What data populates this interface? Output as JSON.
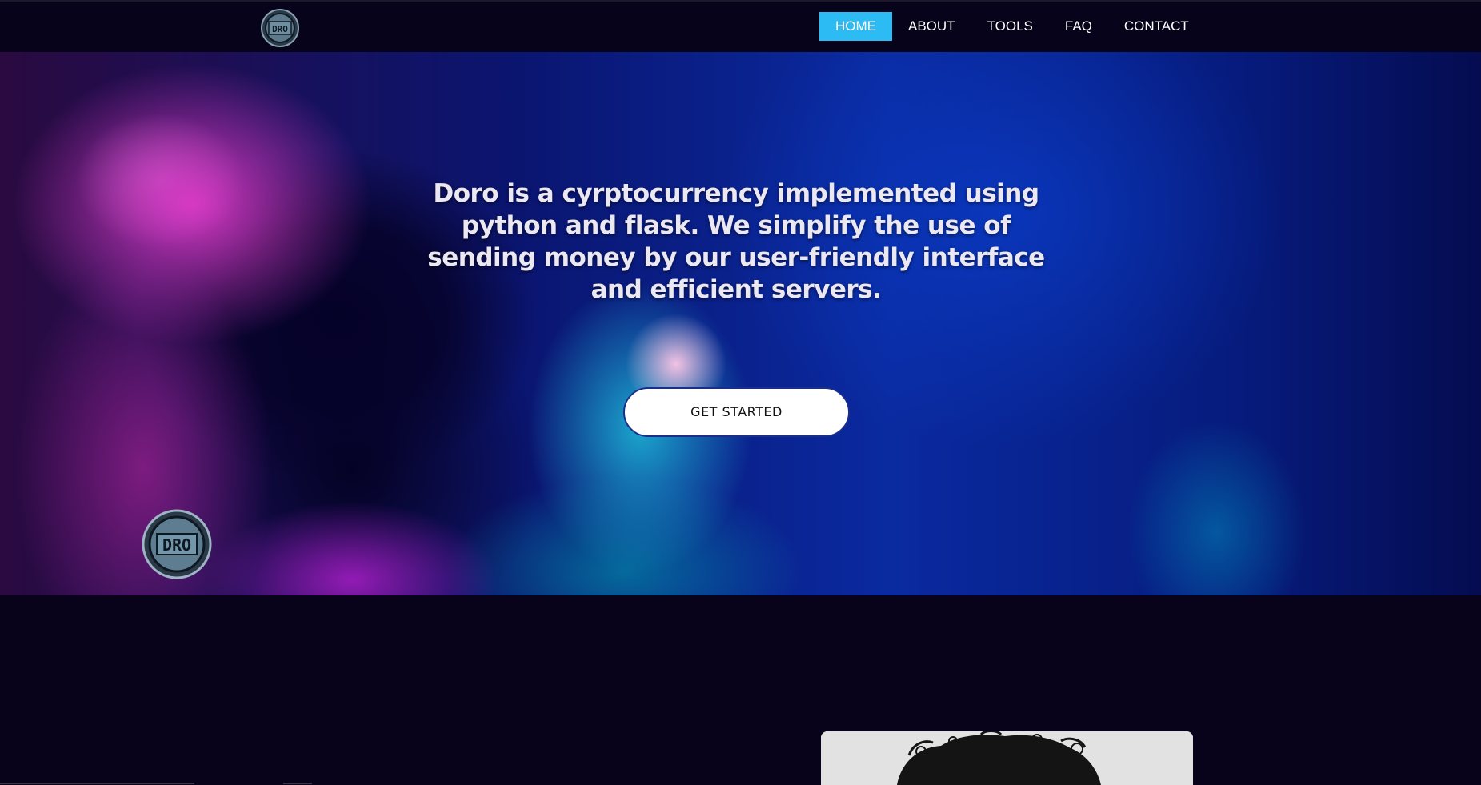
{
  "nav": {
    "logo_icon": "doro-coin-logo-icon",
    "links": [
      {
        "label": "HOME",
        "active": true
      },
      {
        "label": "ABOUT",
        "active": false
      },
      {
        "label": "TOOLS",
        "active": false
      },
      {
        "label": "FAQ",
        "active": false
      },
      {
        "label": "CONTACT",
        "active": false
      }
    ],
    "active_color": "#2dbbf4"
  },
  "hero": {
    "tagline": "Doro is a cyrptocurrency implemented using python and flask. We simplify the use of sending money by our user-friendly interface and efficient servers.",
    "cta_label": "GET STARTED",
    "coin_icon": "doro-coin-icon"
  },
  "about": {
    "photo": "person-curly-hair-photo"
  },
  "colors": {
    "background": "#07031a",
    "button_border": "#1a2e8a",
    "text": "#ece8f2"
  }
}
